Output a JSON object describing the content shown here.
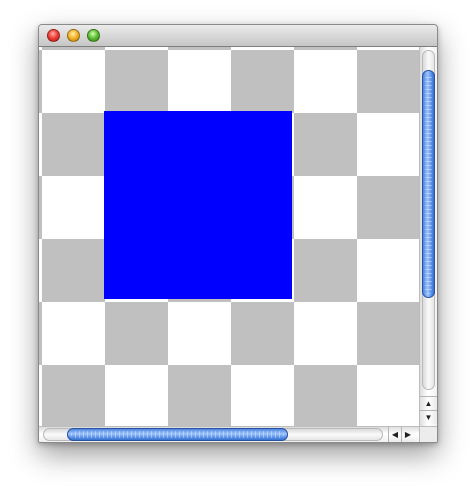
{
  "window": {
    "controls": {
      "close_icon": "close-icon",
      "minimize_icon": "minimize-icon",
      "zoom_icon": "zoom-icon"
    }
  },
  "canvas": {
    "background": "checkerboard",
    "checker_colors": [
      "#c0c0c0",
      "#ffffff"
    ],
    "shape": {
      "type": "square",
      "color": "#0000ff"
    }
  },
  "scrollbars": {
    "vertical": {
      "thumb_start_fraction": 0.06,
      "thumb_size_fraction": 0.67,
      "up_arrow": "▲",
      "down_arrow": "▼"
    },
    "horizontal": {
      "thumb_start_fraction": 0.07,
      "thumb_size_fraction": 0.65,
      "left_arrow": "◀",
      "right_arrow": "▶"
    },
    "thumb_color": "#4a86e8"
  }
}
